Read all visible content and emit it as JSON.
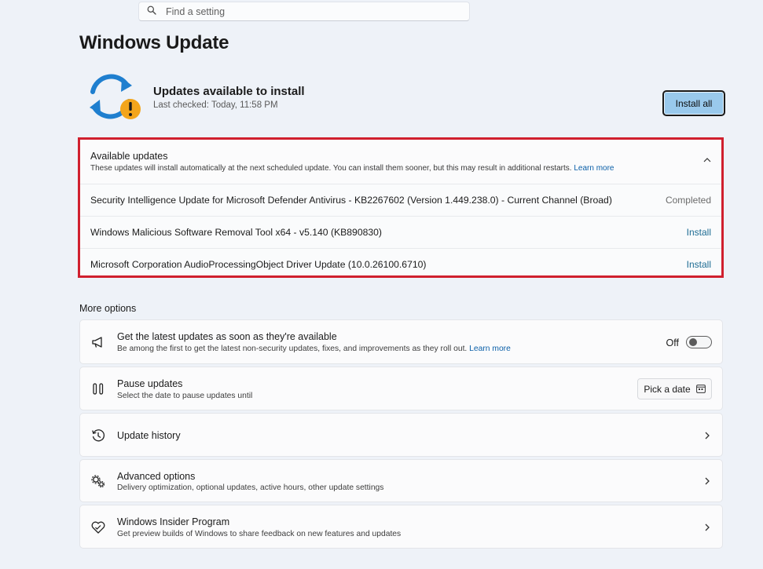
{
  "search": {
    "placeholder": "Find a setting",
    "icon": "search-icon"
  },
  "page": {
    "title": "Windows Update"
  },
  "status": {
    "title": "Updates available to install",
    "last_checked": "Last checked: Today, 11:58 PM",
    "icon": "sync-warning-icon",
    "install_all_label": "Install all"
  },
  "available": {
    "title": "Available updates",
    "description": "These updates will install automatically at the next scheduled update. You can install them sooner, but this may result in additional restarts.",
    "learn_more": "Learn more",
    "updates": [
      {
        "name": "Security Intelligence Update for Microsoft Defender Antivirus - KB2267602 (Version 1.449.238.0) - Current Channel (Broad)",
        "status": "Completed"
      },
      {
        "name": "Windows Malicious Software Removal Tool x64 - v5.140 (KB890830)",
        "status": "Install"
      },
      {
        "name": "Microsoft Corporation AudioProcessingObject Driver Update (10.0.26100.6710)",
        "status": "Install"
      }
    ]
  },
  "more_options": {
    "title": "More options",
    "latest": {
      "title": "Get the latest updates as soon as they're available",
      "subtitle": "Be among the first to get the latest non-security updates, fixes, and improvements as they roll out.",
      "learn_more": "Learn more",
      "toggle_label": "Off",
      "icon": "megaphone-icon"
    },
    "pause": {
      "title": "Pause updates",
      "subtitle": "Select the date to pause updates until",
      "button_label": "Pick a date",
      "icon": "pause-icon"
    },
    "history": {
      "title": "Update history",
      "icon": "history-icon"
    },
    "advanced": {
      "title": "Advanced options",
      "subtitle": "Delivery optimization, optional updates, active hours, other update settings",
      "icon": "gears-icon"
    },
    "insider": {
      "title": "Windows Insider Program",
      "subtitle": "Get preview builds of Windows to share feedback on new features and updates",
      "icon": "insider-heart-icon"
    }
  },
  "colors": {
    "accent": "#99c9ec",
    "highlight_border": "#d0202e",
    "link": "#0a5fa8",
    "install_link": "#1d6c93"
  }
}
